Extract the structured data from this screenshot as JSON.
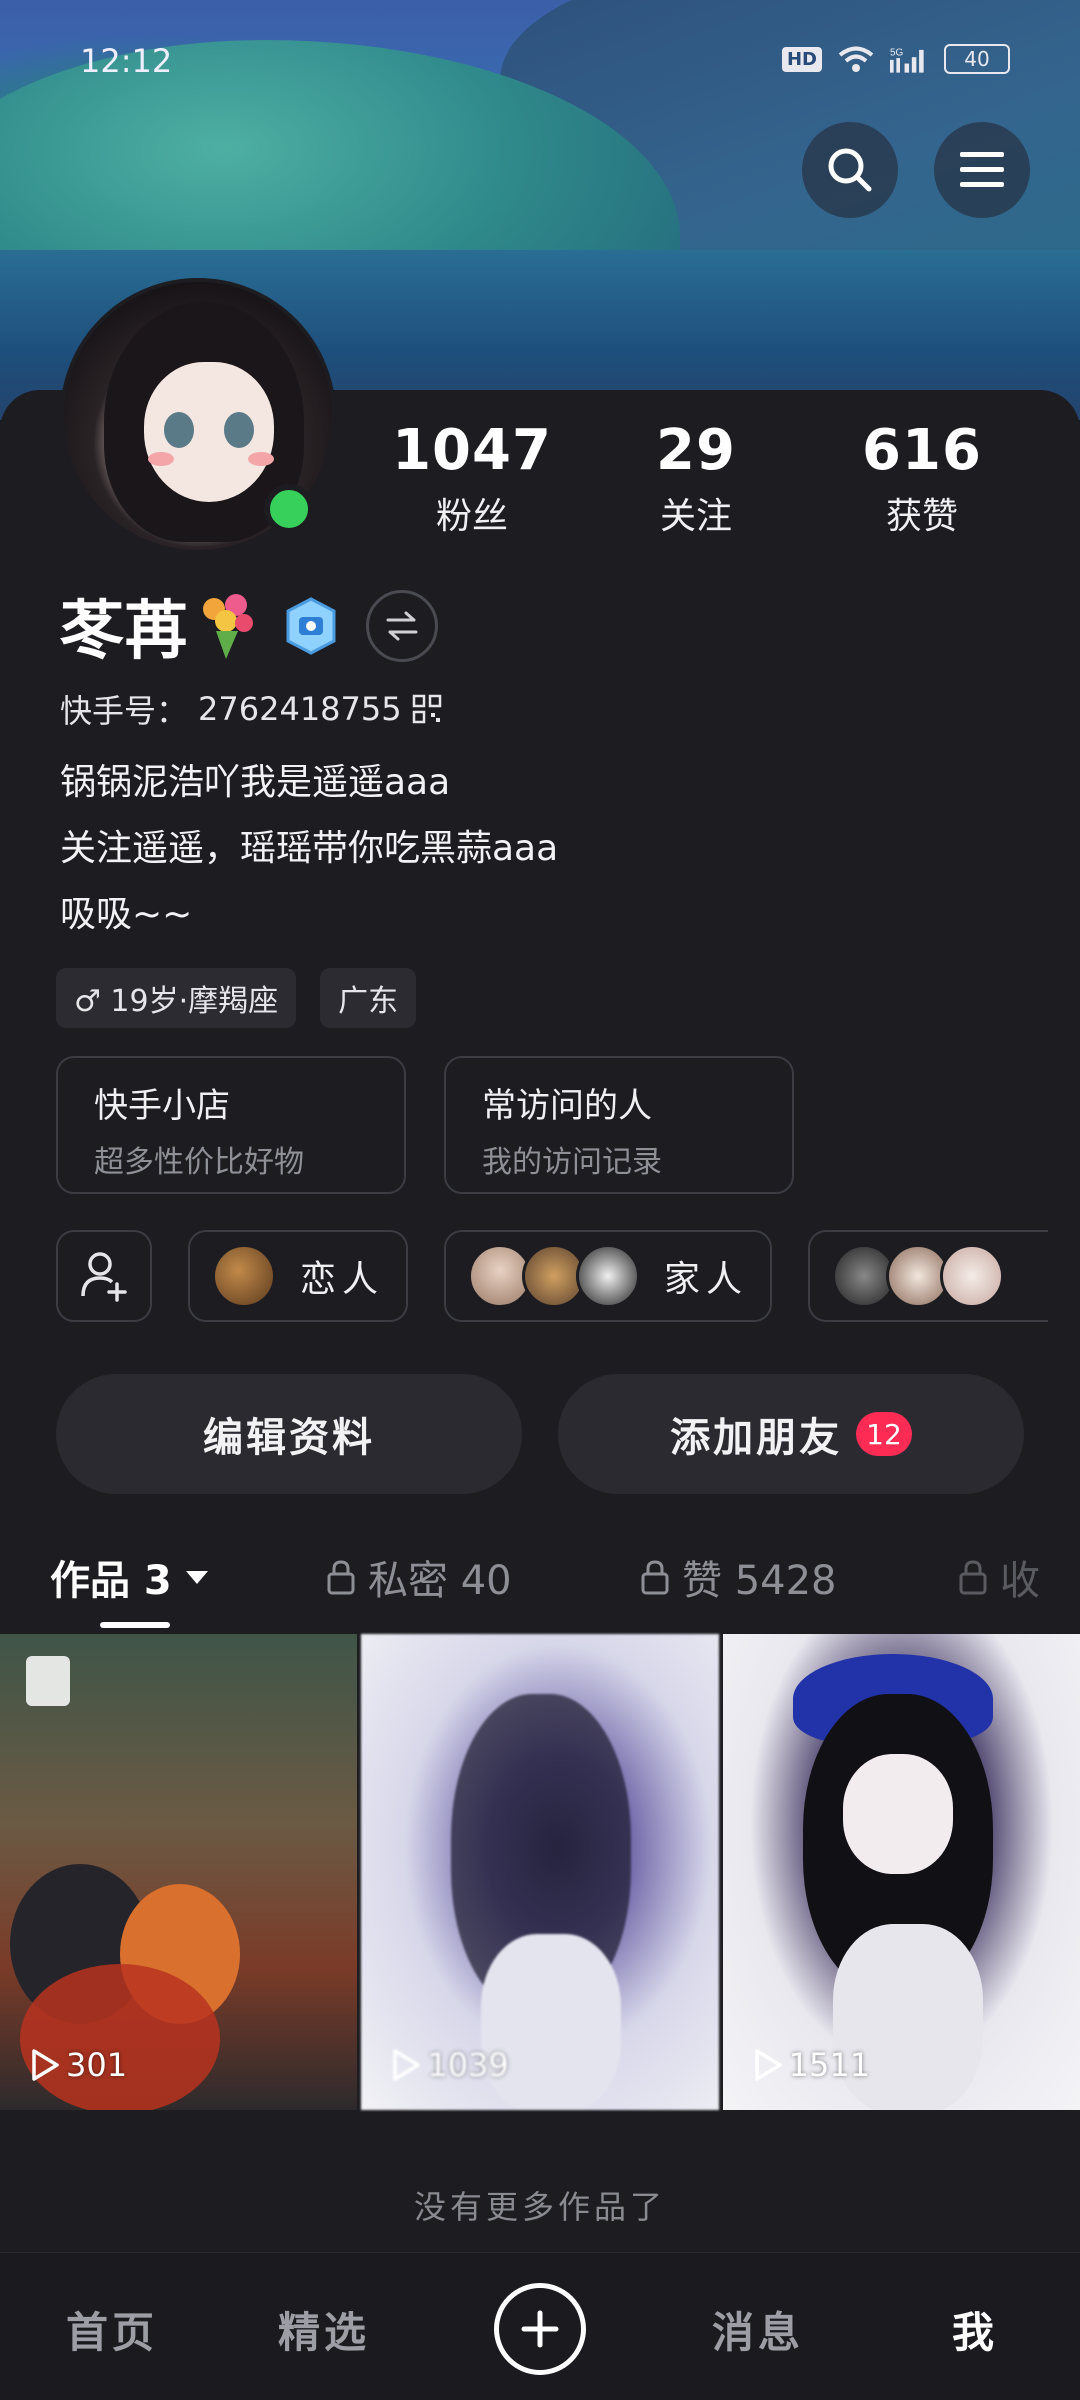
{
  "status_bar": {
    "time": "12:12",
    "hd": "HD",
    "network": "5G",
    "battery": "40"
  },
  "profile": {
    "name": "苳苒",
    "stats": [
      {
        "value": "1047",
        "label": "粉丝"
      },
      {
        "value": "29",
        "label": "关注"
      },
      {
        "value": "616",
        "label": "获赞"
      }
    ],
    "uid_label": "快手号：",
    "uid": "2762418755",
    "bio": [
      "锅锅泥浩吖我是遥遥aaa",
      "关注遥遥，瑶瑶带你吃黑蒜aaa",
      "吸吸~~"
    ],
    "tags": [
      "♂ 19岁·摩羯座",
      "广东"
    ]
  },
  "entries": [
    {
      "title": "快手小店",
      "subtitle": "超多性价比好物"
    },
    {
      "title": "常访问的人",
      "subtitle": "我的访问记录"
    }
  ],
  "friend_groups": [
    {
      "label": "恋人"
    },
    {
      "label": "家人"
    }
  ],
  "actions": {
    "edit": "编辑资料",
    "add_friend": "添加朋友",
    "add_friend_badge": "12"
  },
  "tabs": [
    {
      "label": "作品 3"
    },
    {
      "label": "私密 40"
    },
    {
      "label": "赞 5428"
    },
    {
      "label": "收"
    }
  ],
  "works": [
    {
      "plays": "301"
    },
    {
      "plays": "1039"
    },
    {
      "plays": "1511"
    }
  ],
  "no_more": "没有更多作品了",
  "bottom_nav": {
    "home": "首页",
    "featured": "精选",
    "messages": "消息",
    "me": "我"
  },
  "colors": {
    "accent": "#fe2c55",
    "online": "#37d05b",
    "background": "#1c1c21"
  }
}
